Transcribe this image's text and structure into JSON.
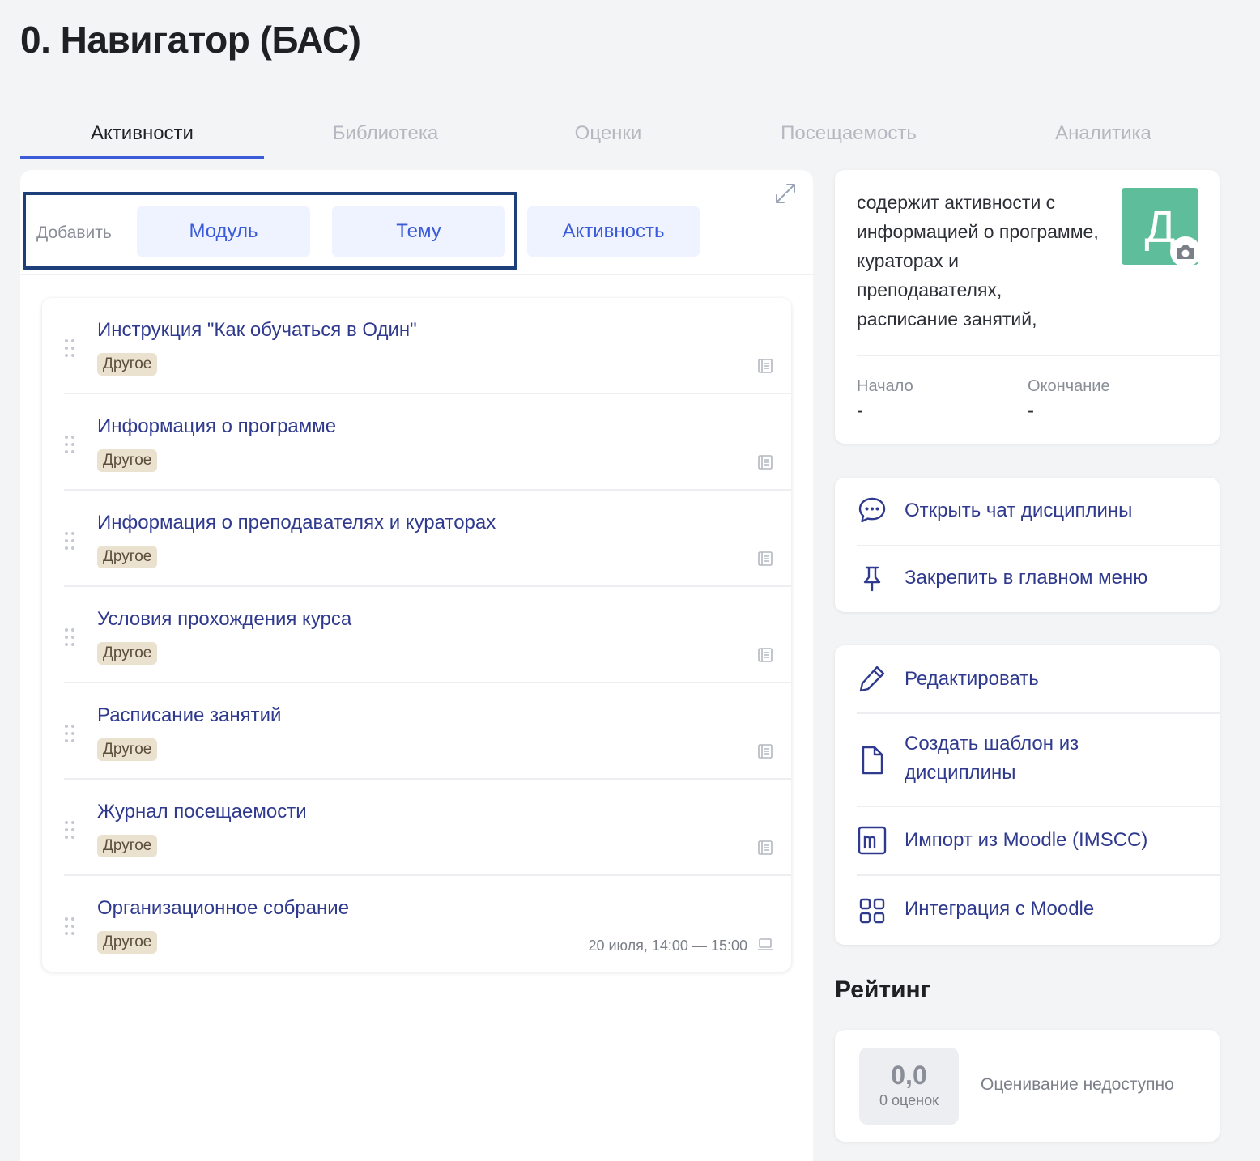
{
  "page": {
    "title": "0. Навигатор (БАС)"
  },
  "tabs": [
    {
      "label": "Активности",
      "active": true
    },
    {
      "label": "Библиотека",
      "active": false
    },
    {
      "label": "Оценки",
      "active": false
    },
    {
      "label": "Посещаемость",
      "active": false
    },
    {
      "label": "Аналитика",
      "active": false
    }
  ],
  "toolbar": {
    "add_label": "Добавить",
    "module_button": "Модуль",
    "topic_button": "Тему",
    "activity_button": "Активность",
    "expand_icon": "expand-icon"
  },
  "activities": [
    {
      "title": "Инструкция \"Как обучаться в Один\"",
      "tag": "Другое",
      "icon": "book-icon"
    },
    {
      "title": "Информация о программе",
      "tag": "Другое",
      "icon": "book-icon"
    },
    {
      "title": "Информация о преподавателях и кураторах",
      "tag": "Другое",
      "icon": "book-icon"
    },
    {
      "title": "Условия прохождения курса",
      "tag": "Другое",
      "icon": "book-icon"
    },
    {
      "title": "Расписание занятий",
      "tag": "Другое",
      "icon": "book-icon"
    },
    {
      "title": "Журнал посещаемости",
      "tag": "Другое",
      "icon": "book-icon"
    },
    {
      "title": "Организационное собрание",
      "tag": "Другое",
      "date": "20 июля, 14:00 — 15:00",
      "icon": "laptop-icon"
    }
  ],
  "info": {
    "description": "содержит активности с информацией о программе, кураторах и преподавателях, расписание занятий,",
    "avatar_letter": "Д",
    "avatar_color": "#5ebe9c",
    "start_label": "Начало",
    "start_value": "-",
    "end_label": "Окончание",
    "end_value": "-"
  },
  "actions_primary": [
    {
      "label": "Открыть чат дисциплины",
      "icon": "chat-icon"
    },
    {
      "label": "Закрепить в главном меню",
      "icon": "pin-icon"
    }
  ],
  "actions_secondary": [
    {
      "label": "Редактировать",
      "icon": "pencil-icon"
    },
    {
      "label": "Создать шаблон из дисциплины",
      "icon": "document-icon"
    },
    {
      "label": "Импорт из Moodle (IMSCC)",
      "icon": "moodle-icon"
    },
    {
      "label": "Интеграция с Moodle",
      "icon": "grid-icon"
    }
  ],
  "rating": {
    "title": "Рейтинг",
    "score": "0,0",
    "count": "0 оценок",
    "note": "Оценивание недоступно"
  },
  "colors": {
    "accent": "#3b5bdb",
    "link": "#2f3a8f",
    "highlight_border": "#1d3f7a",
    "tag_bg": "#ebe1cf"
  }
}
